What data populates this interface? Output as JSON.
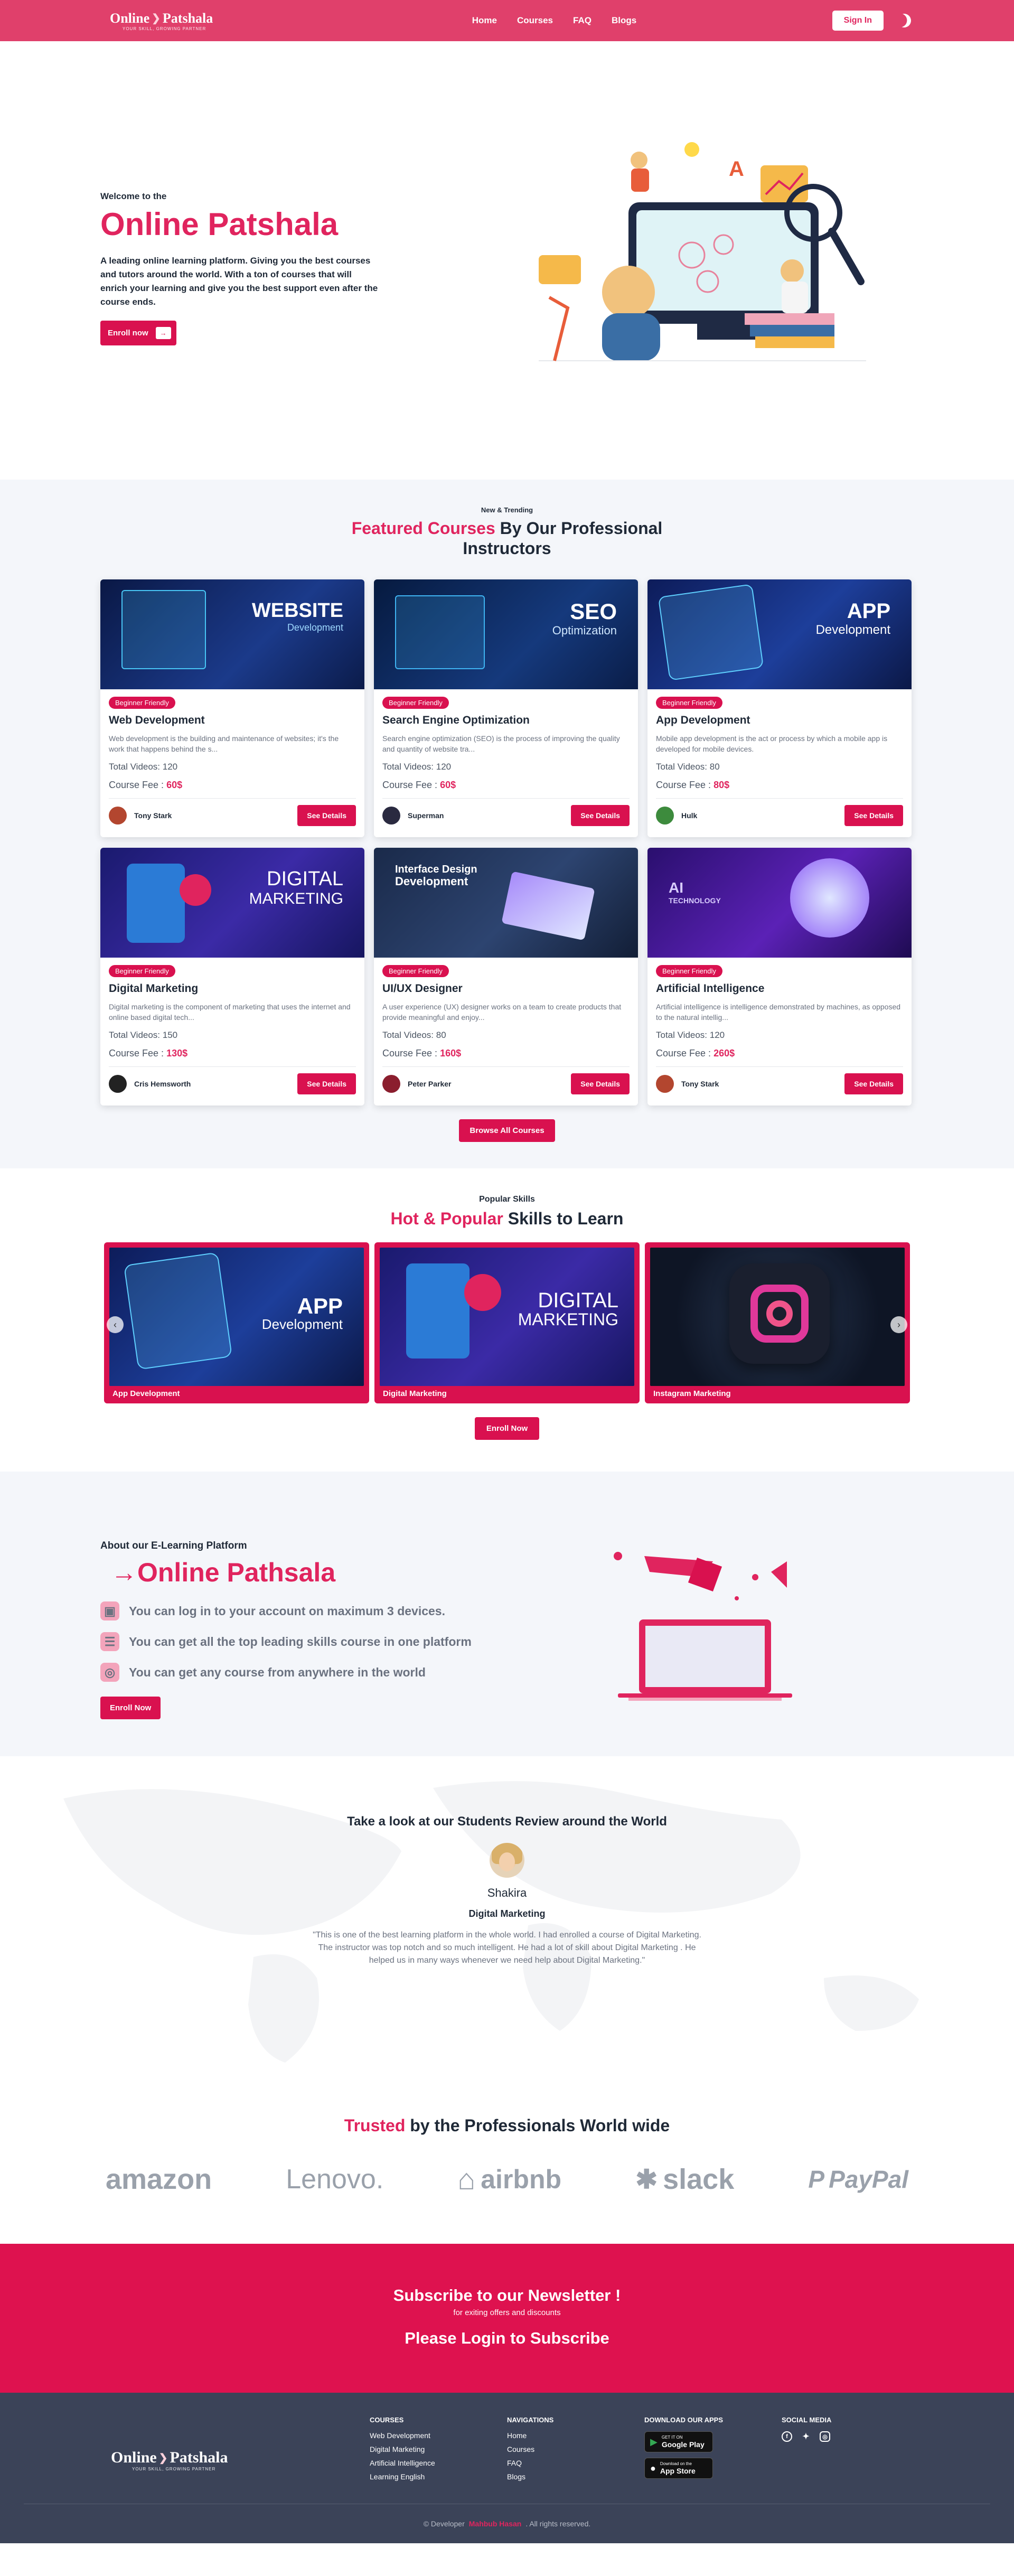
{
  "brand": {
    "name_left": "Online",
    "name_right": "Patshala",
    "tagline": "YOUR SKILL, GROWING PARTNER"
  },
  "nav": {
    "links": [
      "Home",
      "Courses",
      "FAQ",
      "Blogs"
    ],
    "signin": "Sign In"
  },
  "hero": {
    "welcome": "Welcome to the",
    "title": "Online Patshala",
    "description": "A leading online learning platform. Giving you the best courses and tutors around the world. With a ton of courses that will enrich your learning and give you the best support even after the course ends.",
    "enroll": "Enroll now",
    "arrow": "→"
  },
  "featured": {
    "kicker": "New & Trending",
    "title_highlight": "Featured Courses",
    "title_rest": "By Our Professional Instructors",
    "courses": [
      {
        "badge": "Beginner Friendly",
        "title": "Web Development",
        "desc": "Web development is the building and maintenance of websites; it's the work that happens behind the s...",
        "videos_label": "Total Videos:",
        "videos": "120",
        "fee_label": "Course Fee :",
        "fee": "60$",
        "instructor": "Tony Stark",
        "details": "See Details",
        "image_title": "WEBSITE",
        "image_sub": "Development"
      },
      {
        "badge": "Beginner Friendly",
        "title": "Search Engine Optimization",
        "desc": "Search engine optimization (SEO) is the process of improving the quality and quantity of website tra...",
        "videos_label": "Total Videos:",
        "videos": "120",
        "fee_label": "Course Fee :",
        "fee": "60$",
        "instructor": "Superman",
        "details": "See Details",
        "image_title": "SEO",
        "image_sub": "Optimization"
      },
      {
        "badge": "Beginner Friendly",
        "title": "App Development",
        "desc": "Mobile app development is the act or process by which a mobile app is developed for mobile devices.",
        "videos_label": "Total Videos:",
        "videos": "80",
        "fee_label": "Course Fee :",
        "fee": "80$",
        "instructor": "Hulk",
        "details": "See Details",
        "image_title": "APP",
        "image_sub": "Development"
      },
      {
        "badge": "Beginner Friendly",
        "title": "Digital Marketing",
        "desc": "Digital marketing is the component of marketing that uses the internet and online based digital tech...",
        "videos_label": "Total Videos:",
        "videos": "150",
        "fee_label": "Course Fee :",
        "fee": "130$",
        "instructor": "Cris Hemsworth",
        "details": "See Details",
        "image_title": "DIGITAL",
        "image_sub": "MARKETING"
      },
      {
        "badge": "Beginner Friendly",
        "title": "UI/UX Designer",
        "desc": "A user experience (UX) designer works on a team to create products that provide meaningful and enjoy...",
        "videos_label": "Total Videos:",
        "videos": "80",
        "fee_label": "Course Fee :",
        "fee": "160$",
        "instructor": "Peter Parker",
        "details": "See Details",
        "image_title": "Interface Design",
        "image_sub": "Development"
      },
      {
        "badge": "Beginner Friendly",
        "title": "Artificial Intelligence",
        "desc": "Artificial intelligence is intelligence demonstrated by machines, as opposed to the natural intellig...",
        "videos_label": "Total Videos:",
        "videos": "120",
        "fee_label": "Course Fee :",
        "fee": "260$",
        "instructor": "Tony Stark",
        "details": "See Details",
        "image_title": "AI",
        "image_sub": "TECHNOLOGY"
      }
    ],
    "browse": "Browse All Courses"
  },
  "popular": {
    "kicker": "Popular Skills",
    "title_highlight": "Hot & Popular",
    "title_rest": "Skills to Learn",
    "slides": [
      {
        "label": "App Development",
        "image_title": "APP",
        "image_sub": "Development"
      },
      {
        "label": "Digital Marketing",
        "image_title": "DIGITAL",
        "image_sub": "MARKETING"
      },
      {
        "label": "Instagram Marketing",
        "image_title": "",
        "image_sub": ""
      }
    ],
    "enroll": "Enroll Now"
  },
  "about": {
    "kicker": "About our E-Learning Platform",
    "title": "→Online Pathsala",
    "points": [
      "You can log in to your account on maximum 3 devices.",
      "You can get all the top leading skills course in one platform",
      "You can get any course from anywhere in the world"
    ],
    "enroll": "Enroll Now"
  },
  "reviews": {
    "title": "Take a look at our Students Review around the World",
    "name": "Shakira",
    "course": "Digital Marketing",
    "text": "\"This is one of the best learning platform in the whole world. I had enrolled a course of Digital Marketing. The instructor was top notch and so much intelligent. He had a lot of skill about Digital Marketing . He helped us in many ways whenever we need help about Digital Marketing.\""
  },
  "trusted": {
    "title_highlight": "Trusted",
    "title_rest": "by the Professionals World wide",
    "brands": [
      "amazon",
      "Lenovo.",
      "airbnb",
      "slack",
      "PayPal"
    ]
  },
  "subscribe": {
    "title": "Subscribe to our Newsletter !",
    "subtitle": "for exiting offers and discounts",
    "login": "Please Login to Subscribe"
  },
  "footer": {
    "courses_title": "COURSES",
    "courses": [
      "Web Development",
      "Digital Marketing",
      "Artificial Intelligence",
      "Learning English"
    ],
    "nav_title": "NAVIGATIONS",
    "nav": [
      "Home",
      "Courses",
      "FAQ",
      "Blogs"
    ],
    "apps_title": "DOWNLOAD OUR APPS",
    "google_small": "GET IT ON",
    "google": "Google Play",
    "apple_small": "Download on the",
    "apple": "App Store",
    "social_title": "SOCIAL MEDIA",
    "copyright_left": "© Developer",
    "copyright_name": "Mahbub Hasan",
    "copyright_right": ". All rights reserved."
  },
  "colors": {
    "primary": "#d9114f",
    "nav": "#e0406b",
    "footer": "#3b4358"
  }
}
